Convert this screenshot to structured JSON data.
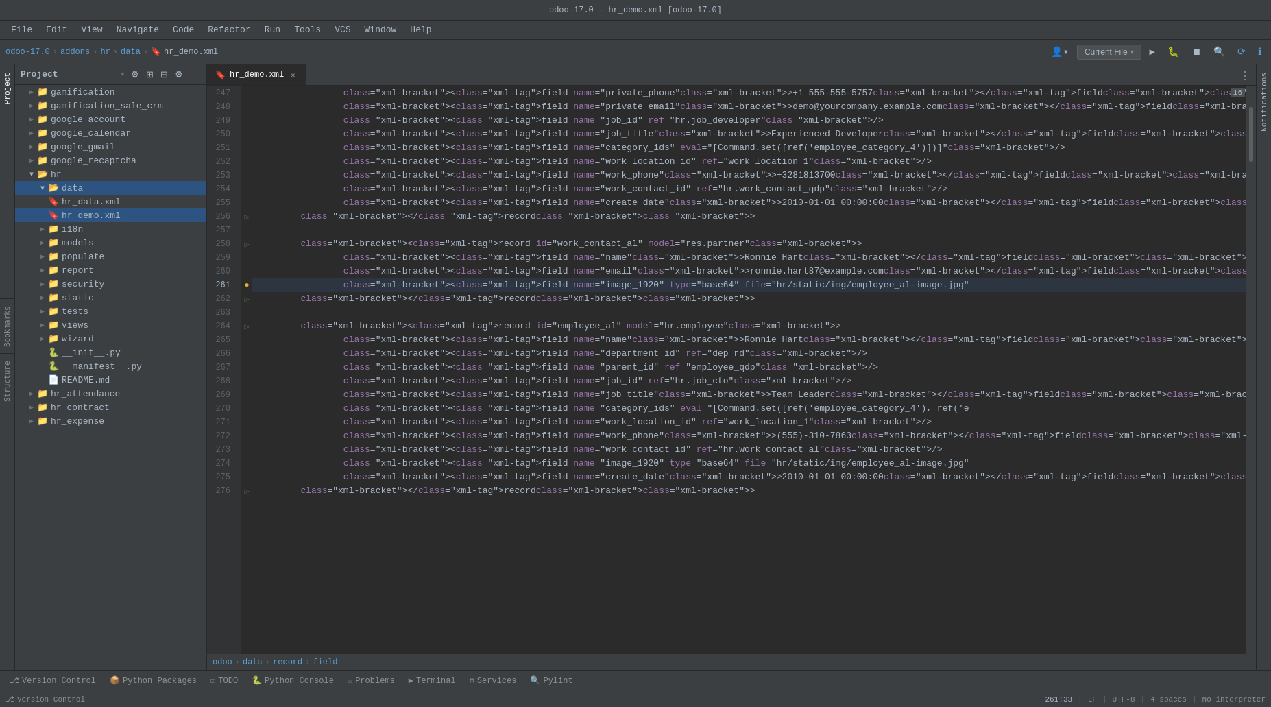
{
  "titlebar": {
    "text": "odoo-17.0 - hr_demo.xml [odoo-17.0]"
  },
  "menubar": {
    "items": [
      "File",
      "Edit",
      "View",
      "Navigate",
      "Code",
      "Refactor",
      "Run",
      "Tools",
      "VCS",
      "Window",
      "Help"
    ]
  },
  "toolbar": {
    "breadcrumb": {
      "parts": [
        "odoo-17.0",
        "addons",
        "hr",
        "data",
        "hr_demo.xml"
      ]
    },
    "dropdown_label": "Current File",
    "dropdown_arrow": "▾"
  },
  "project_panel": {
    "title": "Project",
    "items": [
      {
        "id": "gamification",
        "label": "gamification",
        "type": "folder",
        "indent": 1,
        "open": false
      },
      {
        "id": "gamification_sale_crm",
        "label": "gamification_sale_crm",
        "type": "folder",
        "indent": 1,
        "open": false
      },
      {
        "id": "google_account",
        "label": "google_account",
        "type": "folder",
        "indent": 1,
        "open": false
      },
      {
        "id": "google_calendar",
        "label": "google_calendar",
        "type": "folder",
        "indent": 1,
        "open": false
      },
      {
        "id": "google_gmail",
        "label": "google_gmail",
        "type": "folder",
        "indent": 1,
        "open": false
      },
      {
        "id": "google_recaptcha",
        "label": "google_recaptcha",
        "type": "folder",
        "indent": 1,
        "open": false
      },
      {
        "id": "hr",
        "label": "hr",
        "type": "folder",
        "indent": 1,
        "open": true
      },
      {
        "id": "data",
        "label": "data",
        "type": "folder",
        "indent": 2,
        "open": true
      },
      {
        "id": "hr_data_xml",
        "label": "hr_data.xml",
        "type": "file-xml",
        "indent": 3,
        "open": false
      },
      {
        "id": "hr_demo_xml",
        "label": "hr_demo.xml",
        "type": "file-xml",
        "indent": 3,
        "open": false,
        "selected": true
      },
      {
        "id": "i18n",
        "label": "i18n",
        "type": "folder",
        "indent": 2,
        "open": false
      },
      {
        "id": "models",
        "label": "models",
        "type": "folder",
        "indent": 2,
        "open": false
      },
      {
        "id": "populate",
        "label": "populate",
        "type": "folder",
        "indent": 2,
        "open": false
      },
      {
        "id": "report",
        "label": "report",
        "type": "folder",
        "indent": 2,
        "open": false
      },
      {
        "id": "security",
        "label": "security",
        "type": "folder",
        "indent": 2,
        "open": false
      },
      {
        "id": "static",
        "label": "static",
        "type": "folder",
        "indent": 2,
        "open": false
      },
      {
        "id": "tests",
        "label": "tests",
        "type": "folder",
        "indent": 2,
        "open": false
      },
      {
        "id": "views",
        "label": "views",
        "type": "folder",
        "indent": 2,
        "open": false
      },
      {
        "id": "wizard",
        "label": "wizard",
        "type": "folder",
        "indent": 2,
        "open": false
      },
      {
        "id": "init_py",
        "label": "__init__.py",
        "type": "file-py",
        "indent": 3,
        "open": false
      },
      {
        "id": "manifest_py",
        "label": "__manifest__.py",
        "type": "file-py",
        "indent": 3,
        "open": false
      },
      {
        "id": "readme_md",
        "label": "README.md",
        "type": "file-md",
        "indent": 3,
        "open": false
      },
      {
        "id": "hr_attendance",
        "label": "hr_attendance",
        "type": "folder",
        "indent": 1,
        "open": false
      },
      {
        "id": "hr_contract",
        "label": "hr_contract",
        "type": "folder",
        "indent": 1,
        "open": false
      },
      {
        "id": "hr_expense",
        "label": "hr_expense",
        "type": "folder",
        "indent": 1,
        "open": false
      }
    ]
  },
  "editor": {
    "tab_filename": "hr_demo.xml",
    "lines": [
      {
        "num": 247,
        "indent": 16,
        "content": "<field name=\"private_phone\">+1 555-555-5757</field>",
        "gutter": ""
      },
      {
        "num": 248,
        "indent": 16,
        "content": "<field name=\"private_email\">demo@yourcompany.example.com</field>",
        "gutter": ""
      },
      {
        "num": 249,
        "indent": 16,
        "content": "<field name=\"job_id\" ref=\"hr.job_developer\"/>",
        "gutter": ""
      },
      {
        "num": 250,
        "indent": 16,
        "content": "<field name=\"job_title\">Experienced Developer</field>",
        "gutter": ""
      },
      {
        "num": 251,
        "indent": 16,
        "content": "<field name=\"category_ids\" eval=\"[Command.set([ref('employee_category_4')])]\"/>",
        "gutter": ""
      },
      {
        "num": 252,
        "indent": 16,
        "content": "<field name=\"work_location_id\" ref=\"work_location_1\"/>",
        "gutter": ""
      },
      {
        "num": 253,
        "indent": 16,
        "content": "<field name=\"work_phone\">+3281813700</field>",
        "gutter": ""
      },
      {
        "num": 254,
        "indent": 16,
        "content": "<field name=\"work_contact_id\" ref=\"hr.work_contact_qdp\"/>",
        "gutter": ""
      },
      {
        "num": 255,
        "indent": 16,
        "content": "<field name=\"create_date\">2010-01-01 00:00:00</field>",
        "gutter": ""
      },
      {
        "num": 256,
        "indent": 8,
        "content": "</record>",
        "gutter": "fold"
      },
      {
        "num": 257,
        "indent": 0,
        "content": "",
        "gutter": ""
      },
      {
        "num": 258,
        "indent": 8,
        "content": "<record id=\"work_contact_al\" model=\"res.partner\">",
        "gutter": "fold"
      },
      {
        "num": 259,
        "indent": 16,
        "content": "<field name=\"name\">Ronnie Hart</field>",
        "gutter": ""
      },
      {
        "num": 260,
        "indent": 16,
        "content": "<field name=\"email\">ronnie.hart87@example.com</field>",
        "gutter": ""
      },
      {
        "num": 261,
        "indent": 16,
        "content": "<field name=\"image_1920\" type=\"base64\" file=\"hr/static/img/employee_al-image.jpg\"",
        "gutter": "warn",
        "current": true
      },
      {
        "num": 262,
        "indent": 8,
        "content": "</record>",
        "gutter": "fold"
      },
      {
        "num": 263,
        "indent": 0,
        "content": "",
        "gutter": ""
      },
      {
        "num": 264,
        "indent": 8,
        "content": "<record id=\"employee_al\" model=\"hr.employee\">",
        "gutter": "fold"
      },
      {
        "num": 265,
        "indent": 16,
        "content": "<field name=\"name\">Ronnie Hart</field>",
        "gutter": ""
      },
      {
        "num": 266,
        "indent": 16,
        "content": "<field name=\"department_id\" ref=\"dep_rd\"/>",
        "gutter": ""
      },
      {
        "num": 267,
        "indent": 16,
        "content": "<field name=\"parent_id\" ref=\"employee_qdp\"/>",
        "gutter": ""
      },
      {
        "num": 268,
        "indent": 16,
        "content": "<field name=\"job_id\" ref=\"hr.job_cto\"/>",
        "gutter": ""
      },
      {
        "num": 269,
        "indent": 16,
        "content": "<field name=\"job_title\">Team Leader</field>",
        "gutter": ""
      },
      {
        "num": 270,
        "indent": 16,
        "content": "<field name=\"category_ids\" eval=\"[Command.set([ref('employee_category_4'), ref('e",
        "gutter": ""
      },
      {
        "num": 271,
        "indent": 16,
        "content": "<field name=\"work_location_id\" ref=\"work_location_1\"/>",
        "gutter": ""
      },
      {
        "num": 272,
        "indent": 16,
        "content": "<field name=\"work_phone\">(555)-310-7863</field>",
        "gutter": ""
      },
      {
        "num": 273,
        "indent": 16,
        "content": "<field name=\"work_contact_id\" ref=\"hr.work_contact_al\"/>",
        "gutter": ""
      },
      {
        "num": 274,
        "indent": 16,
        "content": "<field name=\"image_1920\" type=\"base64\" file=\"hr/static/img/employee_al-image.jpg\"",
        "gutter": ""
      },
      {
        "num": 275,
        "indent": 16,
        "content": "<field name=\"create_date\">2010-01-01 00:00:00</field>",
        "gutter": ""
      },
      {
        "num": 276,
        "indent": 8,
        "content": "</record>",
        "gutter": "fold"
      }
    ],
    "breadcrumb": {
      "parts": [
        "odoo",
        "data",
        "record",
        "field"
      ]
    }
  },
  "bottom_tabs": {
    "tabs": [
      {
        "id": "version-control",
        "label": "Version Control",
        "icon": "⎇",
        "active": false
      },
      {
        "id": "python-packages",
        "label": "Python Packages",
        "icon": "📦",
        "active": false
      },
      {
        "id": "todo",
        "label": "TODO",
        "icon": "☑",
        "active": false
      },
      {
        "id": "python-console",
        "label": "Python Console",
        "icon": "🐍",
        "active": false
      },
      {
        "id": "problems",
        "label": "Problems",
        "icon": "⚠",
        "active": false
      },
      {
        "id": "terminal",
        "label": "Terminal",
        "icon": "▶",
        "active": false
      },
      {
        "id": "services",
        "label": "Services",
        "icon": "⚙",
        "active": false
      },
      {
        "id": "pylint",
        "label": "Pylint",
        "icon": "🔍",
        "active": false
      }
    ]
  },
  "statusbar": {
    "cursor": "261:33",
    "line_ending": "LF",
    "encoding": "UTF-8",
    "indent": "4 spaces",
    "interpreter": "No interpreter",
    "line_count_badge": "16"
  },
  "side_panels": {
    "left": [
      {
        "id": "project",
        "label": "Project",
        "active": true
      },
      {
        "id": "bookmarks",
        "label": "Bookmarks",
        "active": false
      },
      {
        "id": "structure",
        "label": "Structure",
        "active": false
      }
    ],
    "right": [
      {
        "id": "notifications",
        "label": "Notifications",
        "active": false
      }
    ]
  }
}
